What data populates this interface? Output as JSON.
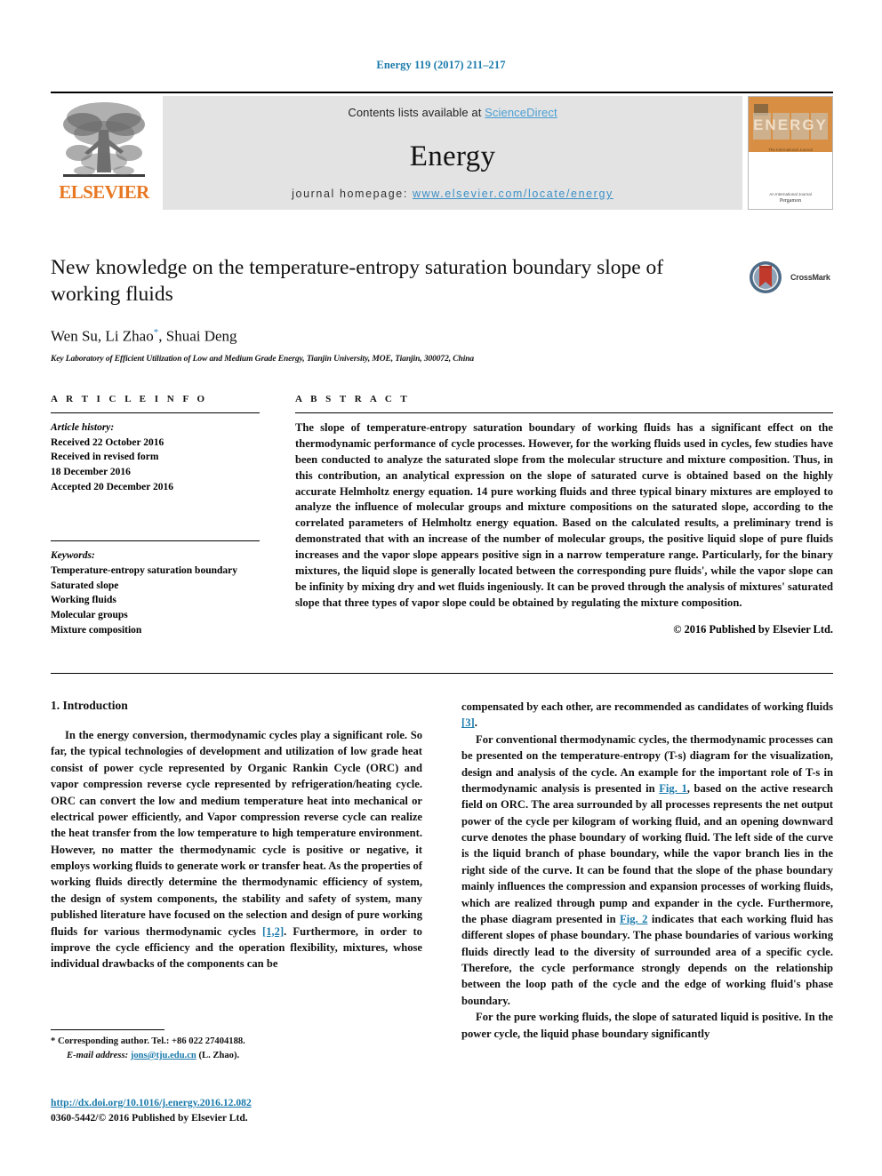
{
  "running_head": "Energy 119 (2017) 211–217",
  "masthead": {
    "contents_prefix": "Contents lists available at ",
    "sciencedirect": "ScienceDirect",
    "journal_name": "Energy",
    "homepage_prefix": "journal homepage: ",
    "homepage_url": "www.elsevier.com/locate/energy",
    "publisher_wordmark": "ELSEVIER",
    "publisher_logo_icon": "elsevier-tree-icon",
    "cover": {
      "title": "ENERGY",
      "subtitle": "The International Journal",
      "footer_text": "An International Journal",
      "brand": "Pergamon"
    },
    "colors": {
      "elsevier_orange": "#E87722",
      "sciencedirect_blue": "#4a9fd4",
      "link_blue": "#1a7aab",
      "masthead_gray": "#e3e3e3",
      "cover_orange": "#d98f43"
    }
  },
  "article": {
    "title": "New knowledge on the temperature-entropy saturation boundary slope of working fluids",
    "authors": "Wen Su, Li Zhao",
    "authors_tail": ", Shuai Deng",
    "corresponding_marker": "*",
    "affiliation": "Key Laboratory of Efficient Utilization of Low and Medium Grade Energy, Tianjin University, MOE, Tianjin, 300072, China",
    "crossmark_label": "CrossMark",
    "crossmark_icon": "crossmark-icon"
  },
  "article_info": {
    "heading": "A R T I C L E  I N F O",
    "history_label": "Article history:",
    "history": [
      "Received 22 October 2016",
      "Received in revised form",
      "18 December 2016",
      "Accepted 20 December 2016"
    ],
    "keywords_label": "Keywords:",
    "keywords": [
      "Temperature-entropy saturation boundary",
      "Saturated slope",
      "Working fluids",
      "Molecular groups",
      "Mixture composition"
    ]
  },
  "abstract": {
    "heading": "A B S T R A C T",
    "text": "The slope of temperature-entropy saturation boundary of working fluids has a significant effect on the thermodynamic performance of cycle processes. However, for the working fluids used in cycles, few studies have been conducted to analyze the saturated slope from the molecular structure and mixture composition. Thus, in this contribution, an analytical expression on the slope of saturated curve is obtained based on the highly accurate Helmholtz energy equation. 14 pure working fluids and three typical binary mixtures are employed to analyze the influence of molecular groups and mixture compositions on the saturated slope, according to the correlated parameters of Helmholtz energy equation. Based on the calculated results, a preliminary trend is demonstrated that with an increase of the number of molecular groups, the positive liquid slope of pure fluids increases and the vapor slope appears positive sign in a narrow temperature range. Particularly, for the binary mixtures, the liquid slope is generally located between the corresponding pure fluids', while the vapor slope can be infinity by mixing dry and wet fluids ingeniously. It can be proved through the analysis of mixtures' saturated slope that three types of vapor slope could be obtained by regulating the mixture composition.",
    "copyright": "© 2016 Published by Elsevier Ltd."
  },
  "body": {
    "section_number_title": "1. Introduction",
    "left_para_1_a": "In the energy conversion, thermodynamic cycles play a significant role. So far, the typical technologies of development and utilization of low grade heat consist of power cycle represented by Organic Rankin Cycle (ORC) and vapor compression reverse cycle represented by refrigeration/heating cycle. ORC can convert the low and medium temperature heat into mechanical or electrical power efficiently, and Vapor compression reverse cycle can realize the heat transfer from the low temperature to high temperature environment. However, no matter the thermodynamic cycle is positive or negative, it employs working fluids to generate work or transfer heat. As the properties of working fluids directly determine the thermodynamic efficiency of system, the design of system components, the stability and safety of system, many published literature have focused on the selection and design of pure working fluids for various thermodynamic cycles ",
    "ref_1_2": "[1,2]",
    "left_para_1_b": ". Furthermore, in order to improve the cycle efficiency and the operation flexibility, mixtures, whose individual drawbacks of the components can be",
    "right_para_1_a": "compensated by each other, are recommended as candidates of working fluids ",
    "ref_3": "[3]",
    "right_para_1_b": ".",
    "right_para_2_a": "For conventional thermodynamic cycles, the thermodynamic processes can be presented on the temperature-entropy (T-s) diagram for the visualization, design and analysis of the cycle. An example for the important role of T-s in thermodynamic analysis is presented in ",
    "fig_1": "Fig. 1",
    "right_para_2_b": ", based on the active research field on ORC. The area surrounded by all processes represents the net output power of the cycle per kilogram of working fluid, and an opening downward curve denotes the phase boundary of working fluid. The left side of the curve is the liquid branch of phase boundary, while the vapor branch lies in the right side of the curve. It can be found that the slope of the phase boundary mainly influences the compression and expansion processes of working fluids, which are realized through pump and expander in the cycle. Furthermore, the phase diagram presented in ",
    "fig_2": "Fig. 2",
    "right_para_2_c": " indicates that each working fluid has different slopes of phase boundary. The phase boundaries of various working fluids directly lead to the diversity of surrounded area of a specific cycle. Therefore, the cycle performance strongly depends on the relationship between the loop path of the cycle and the edge of working fluid's phase boundary.",
    "right_para_3": "For the pure working fluids, the slope of saturated liquid is positive. In the power cycle, the liquid phase boundary significantly"
  },
  "footer": {
    "corresponding_marker": "*",
    "corresponding_text": "Corresponding author. Tel.: +86 022 27404188.",
    "email_label": "E-mail address:",
    "email": "jons@tju.edu.cn",
    "email_suffix": "(L. Zhao).",
    "doi": "http://dx.doi.org/10.1016/j.energy.2016.12.082",
    "issn_line": "0360-5442/© 2016 Published by Elsevier Ltd."
  }
}
